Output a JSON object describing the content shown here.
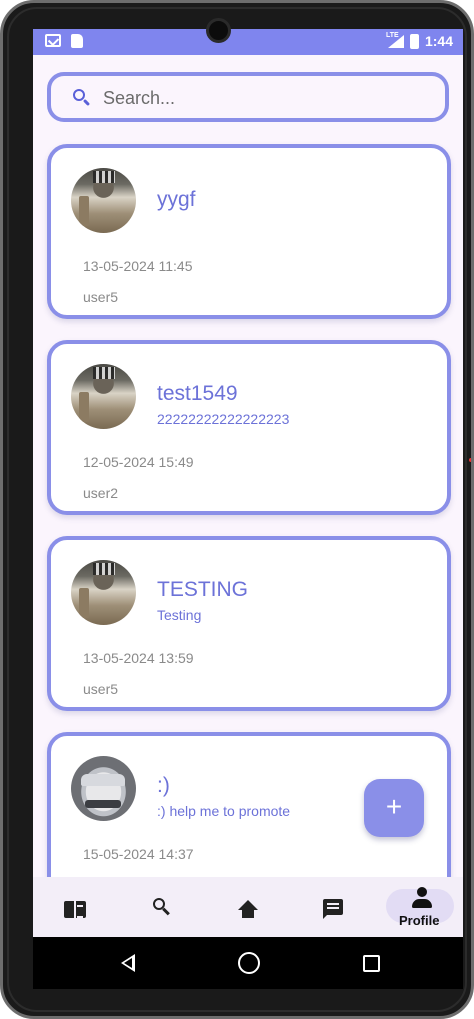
{
  "status_bar": {
    "time": "1:44",
    "network": "LTE",
    "icons": [
      "mail-icon",
      "sd-card-icon",
      "signal-icon",
      "battery-icon"
    ]
  },
  "search": {
    "placeholder": "Search...",
    "value": ""
  },
  "posts": [
    {
      "title": "yygf",
      "subtitle": "",
      "date": "13-05-2024 11:45",
      "user": "user5"
    },
    {
      "title": "test1549",
      "subtitle": "22222222222222223",
      "date": "12-05-2024 15:49",
      "user": "user2"
    },
    {
      "title": "TESTING",
      "subtitle": "Testing",
      "date": "13-05-2024 13:59",
      "user": "user5"
    },
    {
      "title": ":)",
      "subtitle": ":) help me to promote",
      "date": "15-05-2024 14:37",
      "user": ""
    }
  ],
  "fab": {
    "label": "+"
  },
  "bottom_nav": {
    "items": [
      {
        "icon": "feed-icon"
      },
      {
        "icon": "search-icon"
      },
      {
        "icon": "home-icon"
      },
      {
        "icon": "chat-icon"
      },
      {
        "icon": "person-icon",
        "label": "Profile",
        "active": true
      }
    ]
  },
  "colors": {
    "accent": "#8a8fe8",
    "title_text": "#6c72d8",
    "status_bar": "#7f85ee",
    "background": "#fbf5fd"
  }
}
